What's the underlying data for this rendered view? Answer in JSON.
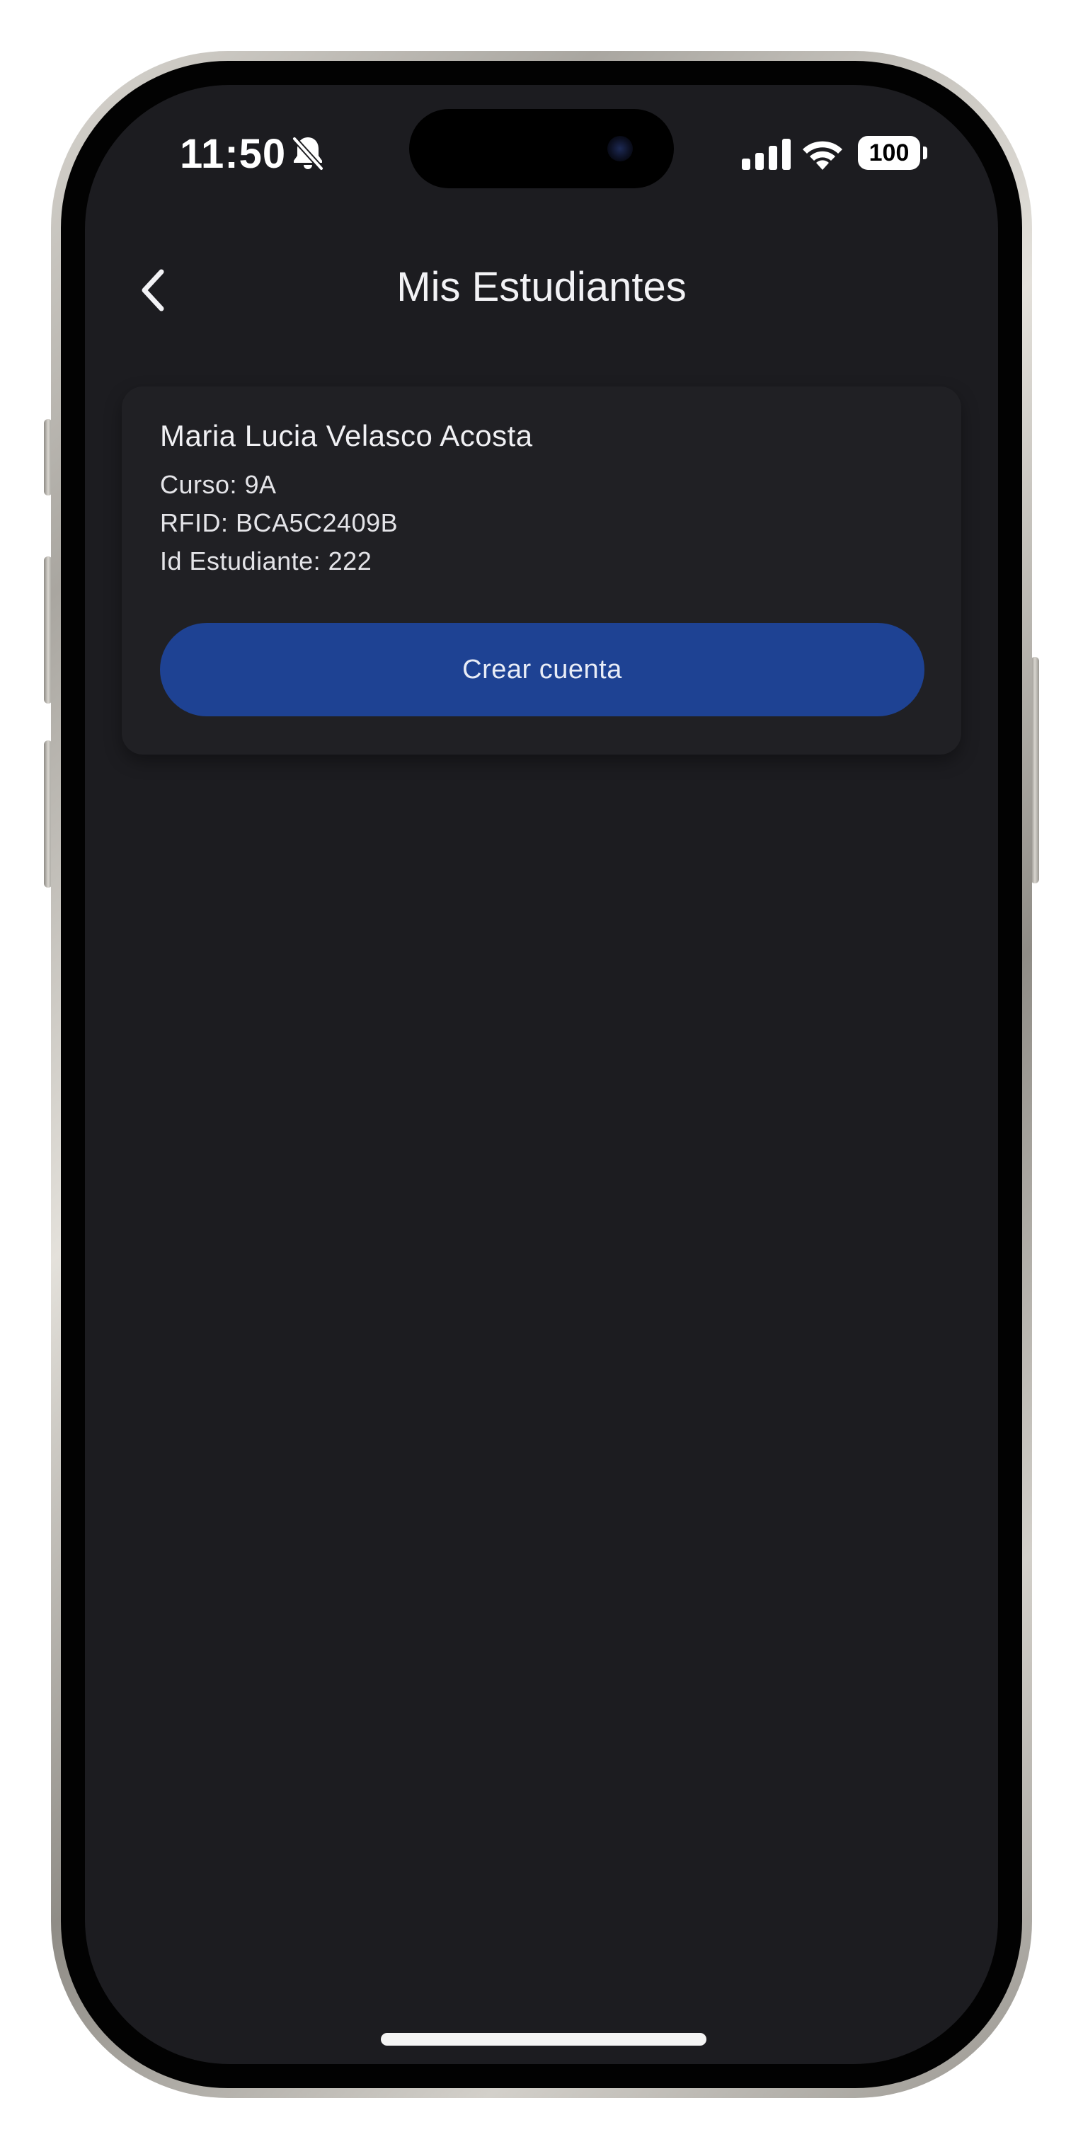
{
  "status_bar": {
    "time": "11:50",
    "battery": "100",
    "icons": [
      "bell-slash-icon",
      "cellular-signal-icon",
      "wifi-icon",
      "battery-icon"
    ]
  },
  "header": {
    "title": "Mis Estudiantes",
    "back_icon": "chevron-left-icon"
  },
  "student": {
    "name": "Maria Lucia Velasco Acosta",
    "curso": "Curso: 9A",
    "rfid": "RFID: BCA5C2409B",
    "id": "Id Estudiante: 222",
    "button_label": "Crear cuenta"
  },
  "colors": {
    "background": "#1c1c20",
    "card": "#202024",
    "button": "#1e4293"
  }
}
